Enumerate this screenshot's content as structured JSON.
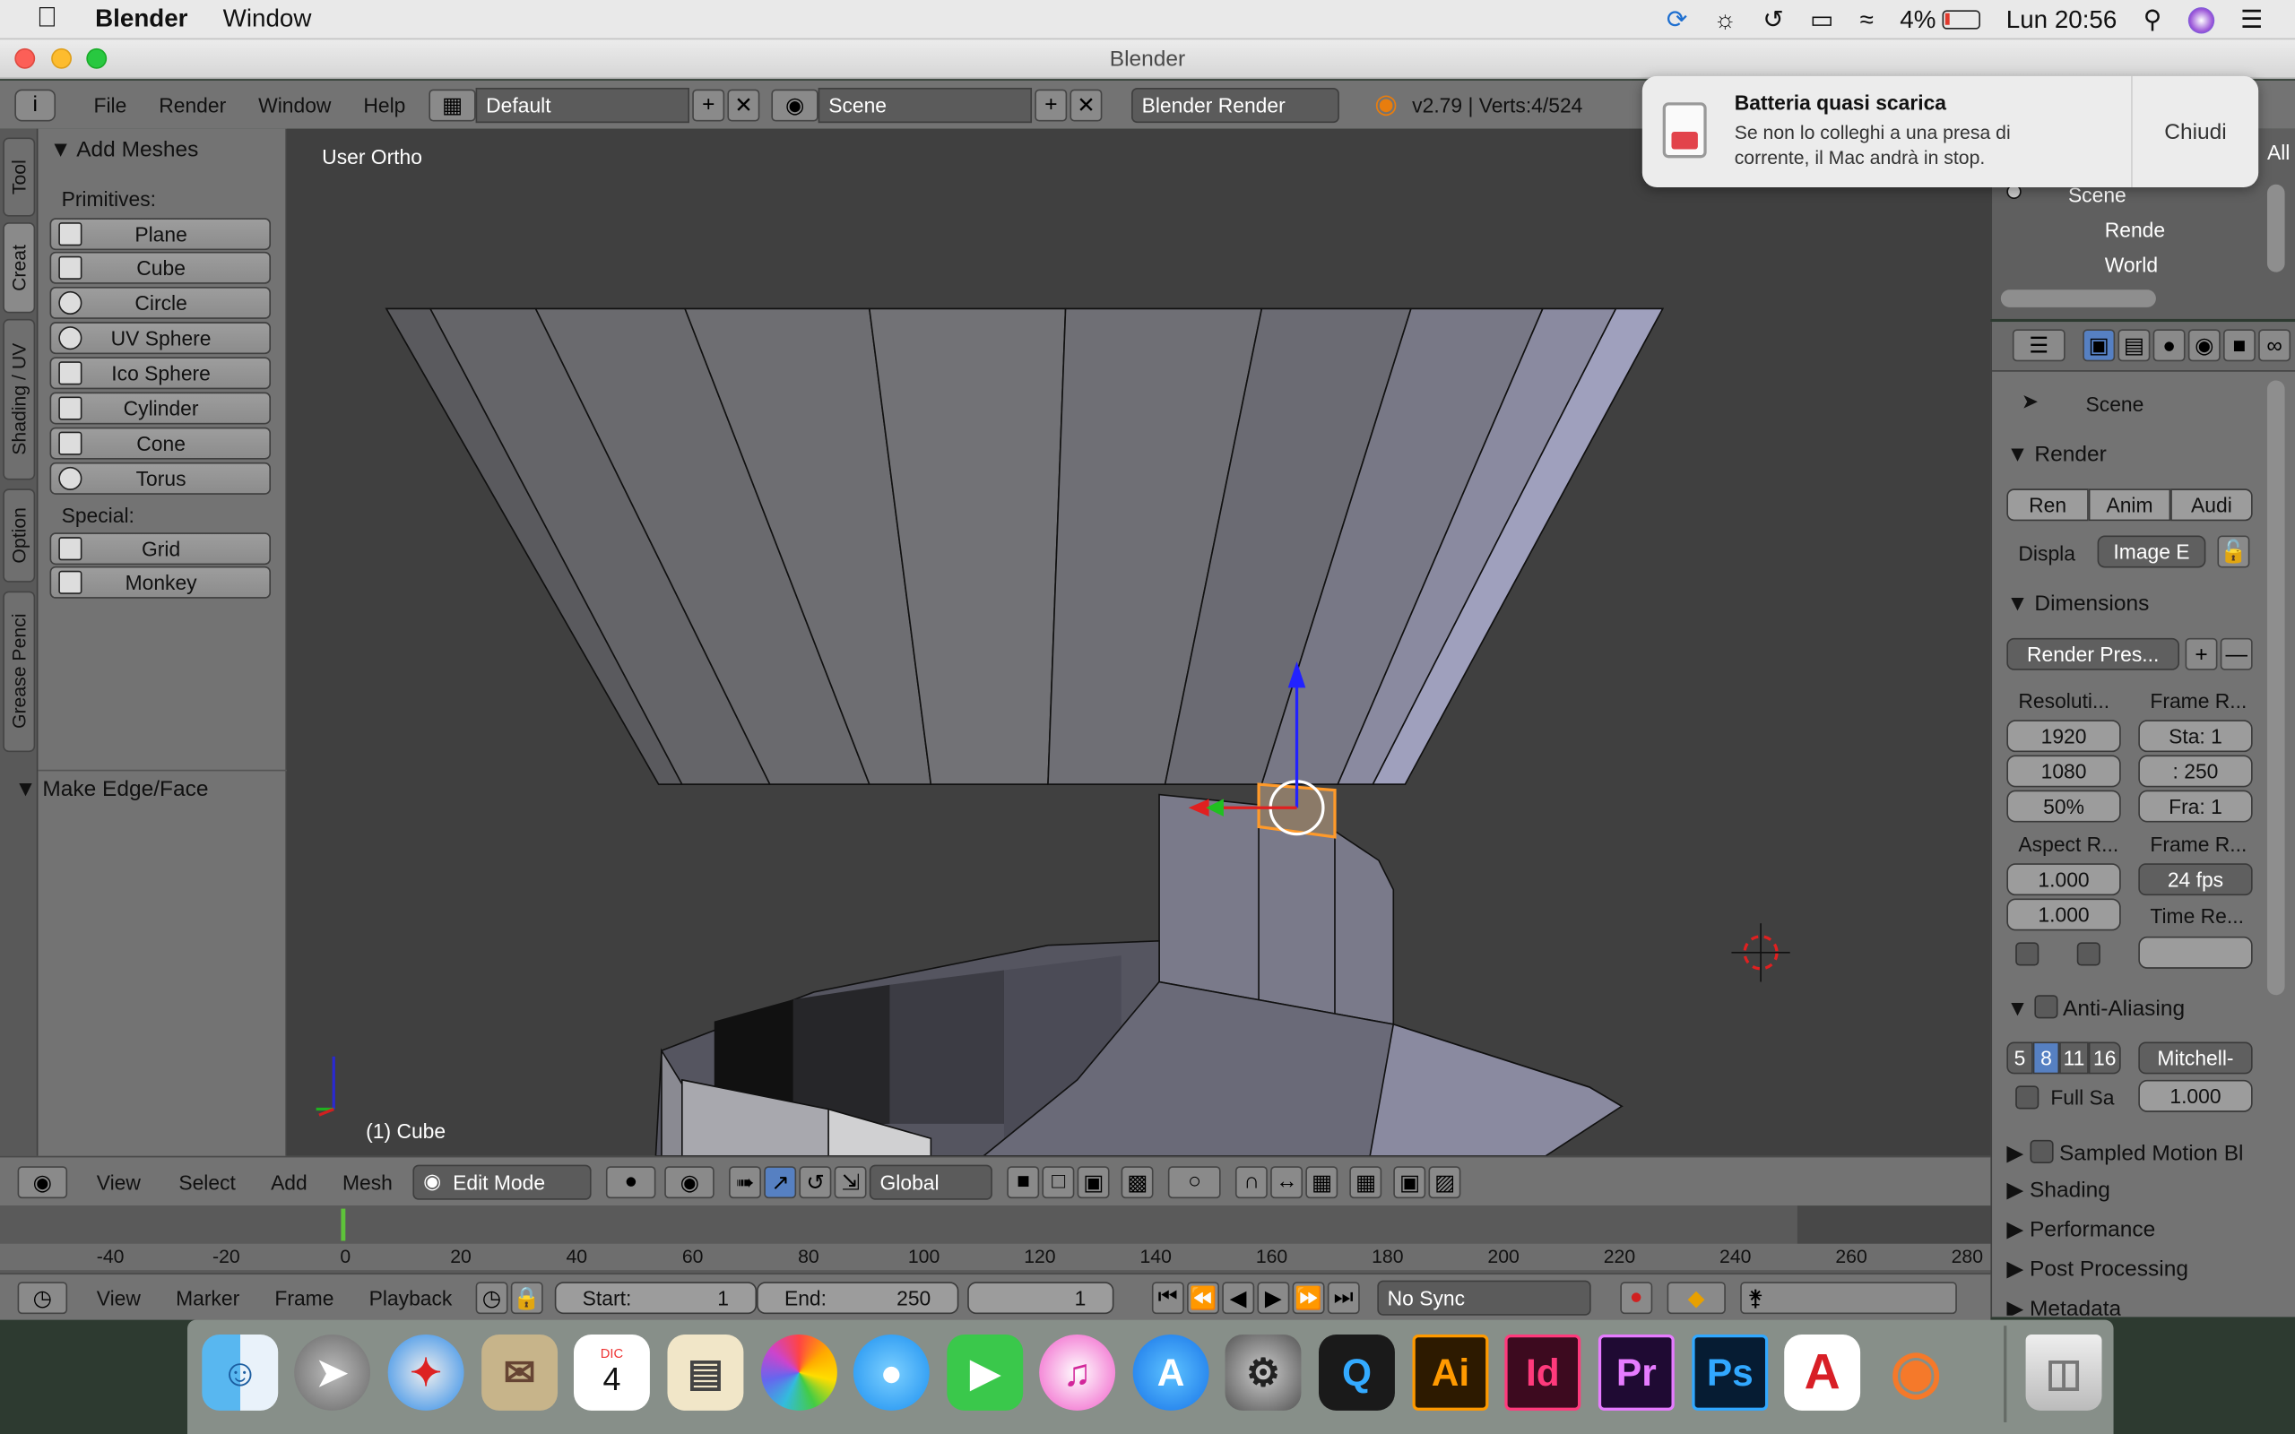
{
  "menubar": {
    "app": "Blender",
    "window": "Window",
    "battery": "4%",
    "clock": "Lun 20:56"
  },
  "window": {
    "title": "Blender"
  },
  "header": {
    "file": "File",
    "render": "Render",
    "window": "Window",
    "help": "Help",
    "layout": "Default",
    "scene": "Scene",
    "engine": "Blender Render",
    "version": "v2.79 | Verts:4/524"
  },
  "tabs": [
    "Tool",
    "Creat",
    "Shading / UV",
    "Option",
    "Grease Penci"
  ],
  "toolshelf": {
    "title": "Add Meshes",
    "primitives_label": "Primitives:",
    "special_label": "Special:",
    "buttons": [
      "Plane",
      "Cube",
      "Circle",
      "UV Sphere",
      "Ico Sphere",
      "Cylinder",
      "Cone",
      "Torus"
    ],
    "special": [
      "Grid",
      "Monkey"
    ],
    "make_edge": "Make Edge/Face"
  },
  "viewport": {
    "label": "User Ortho",
    "object": "(1) Cube"
  },
  "notification": {
    "title": "Batteria quasi scarica",
    "body1": "Se non lo colleghi a una presa di",
    "body2": "corrente, il Mac andrà in stop.",
    "close": "Chiudi"
  },
  "outliner": {
    "items": [
      "Scene",
      "Rende",
      "World"
    ],
    "top": "All"
  },
  "props": {
    "scene": "Scene",
    "render": "Render",
    "ren": "Ren",
    "anim": "Anim",
    "audi": "Audi",
    "displa": "Displa",
    "image": "Image E",
    "dimensions": "Dimensions",
    "presets": "Render Pres...",
    "resolution": "Resoluti...",
    "frame_range": "Frame R...",
    "res_x": "1920",
    "res_y": "1080",
    "res_pct": "50%",
    "start": "Sta: 1",
    "end": ":  250",
    "frame": "Fra: 1",
    "aspect": "Aspect R...",
    "frame_rate": "Frame R...",
    "asp_x": "1.000",
    "asp_y": "1.000",
    "fps": "24 fps",
    "time_remap": "Time Re...",
    "aa": "Anti-Aliasing",
    "aa_samples": [
      "5",
      "8",
      "11",
      "16"
    ],
    "filter": "Mitchell-",
    "fullsa": "Full Sa",
    "filter_size": "1.000",
    "motion_blur": "Sampled Motion Bl",
    "shading": "Shading",
    "performance": "Performance",
    "post": "Post Processing",
    "metadata": "Metadata"
  },
  "vpheader": {
    "view": "View",
    "select": "Select",
    "add": "Add",
    "mesh": "Mesh",
    "mode": "Edit Mode",
    "orientation": "Global"
  },
  "timeline": {
    "ticks": [
      "-40",
      "-20",
      "0",
      "20",
      "40",
      "60",
      "80",
      "100",
      "120",
      "140",
      "160",
      "180",
      "200",
      "220",
      "240",
      "260",
      "280"
    ]
  },
  "tlheader": {
    "view": "View",
    "marker": "Marker",
    "frame": "Frame",
    "playback": "Playback",
    "start_label": "Start:",
    "start": "1",
    "end_label": "End:",
    "end": "250",
    "current": "1",
    "sync": "No Sync"
  },
  "dock": {
    "ai": "Ai",
    "id": "Id",
    "pr": "Pr",
    "ps": "Ps",
    "cal_month": "DIC",
    "cal_day": "4"
  }
}
